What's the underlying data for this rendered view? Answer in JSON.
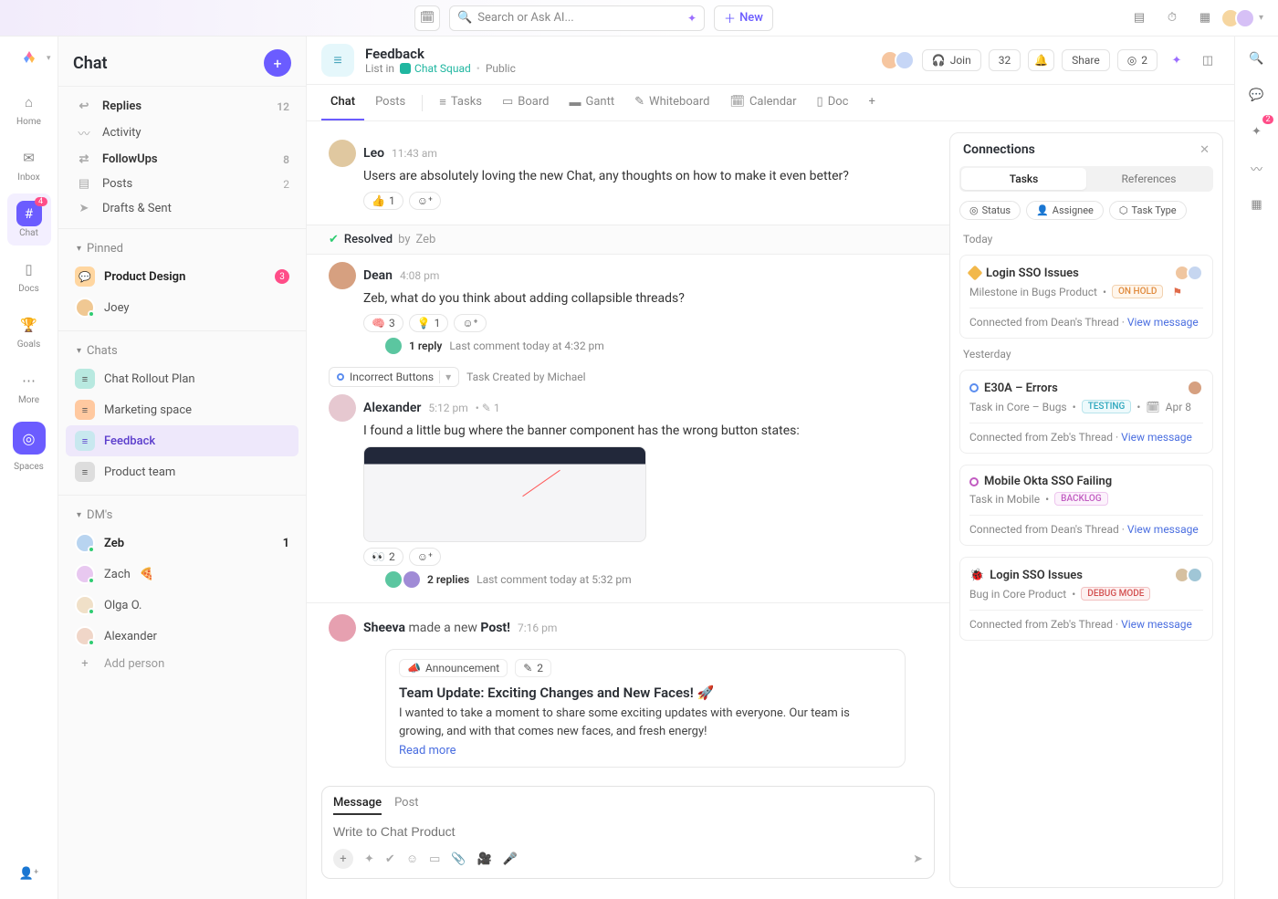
{
  "topbar": {
    "search_placeholder": "Search or Ask AI...",
    "new_label": "New"
  },
  "rail": {
    "items": [
      {
        "label": "Home"
      },
      {
        "label": "Inbox"
      },
      {
        "label": "Chat",
        "badge": "4"
      },
      {
        "label": "Docs"
      },
      {
        "label": "Goals"
      },
      {
        "label": "More"
      }
    ],
    "spaces_label": "Spaces"
  },
  "sidebar": {
    "title": "Chat",
    "nav": [
      {
        "label": "Replies",
        "count": "12",
        "bold": true,
        "icon": "↩"
      },
      {
        "label": "Activity",
        "icon": "⟳"
      },
      {
        "label": "FollowUps",
        "count": "8",
        "bold": true,
        "icon": "⇄"
      },
      {
        "label": "Posts",
        "count": "2",
        "icon": "▤"
      },
      {
        "label": "Drafts & Sent",
        "icon": "➤"
      }
    ],
    "pinned_label": "Pinned",
    "pinned": [
      {
        "label": "Product Design",
        "badge": "3",
        "bold": true
      },
      {
        "label": "Joey"
      }
    ],
    "chats_label": "Chats",
    "chats": [
      {
        "label": "Chat Rollout Plan"
      },
      {
        "label": "Marketing space"
      },
      {
        "label": "Feedback",
        "active": true
      },
      {
        "label": "Product team"
      }
    ],
    "dms_label": "DM's",
    "dms": [
      {
        "label": "Zeb",
        "badge": "1",
        "bold": true
      },
      {
        "label": "Zach",
        "emoji": "🍕"
      },
      {
        "label": "Olga O."
      },
      {
        "label": "Alexander"
      }
    ],
    "add_person": "Add person"
  },
  "header": {
    "title": "Feedback",
    "sub_prefix": "List in",
    "squad": "Chat Squad",
    "visibility": "Public",
    "join_label": "Join",
    "member_count": "32",
    "share_label": "Share",
    "viewers": "2"
  },
  "tabs": {
    "primary": [
      "Chat",
      "Posts"
    ],
    "views": [
      "Tasks",
      "Board",
      "Gantt",
      "Whiteboard",
      "Calendar",
      "Doc"
    ]
  },
  "messages": [
    {
      "author": "Leo",
      "time": "11:43 am",
      "text": "Users are absolutely loving the new Chat, any thoughts on how to make it even better?",
      "reactions": [
        {
          "emoji": "👍",
          "count": "1"
        }
      ]
    }
  ],
  "resolved": {
    "label": "Resolved",
    "by_prefix": "by",
    "by": "Zeb"
  },
  "msg2": {
    "author": "Dean",
    "time": "4:08 pm",
    "text": "Zeb, what do you think about adding collapsible threads?",
    "reactions": [
      {
        "emoji": "🧠",
        "count": "3"
      },
      {
        "emoji": "💡",
        "count": "1"
      }
    ],
    "reply_count": "1 reply",
    "reply_meta": "Last comment today at 4:32 pm"
  },
  "task_created": {
    "name": "Incorrect Buttons",
    "label": "Task Created",
    "by_prefix": "by",
    "by": "Michael"
  },
  "msg3": {
    "author": "Alexander",
    "time": "5:12 pm",
    "extra": "1",
    "text": "I found a little bug where the banner component has the wrong button states:",
    "reactions": [
      {
        "emoji": "👀",
        "count": "2"
      }
    ],
    "reply_count": "2 replies",
    "reply_meta": "Last comment today at 5:32 pm"
  },
  "post": {
    "author": "Sheeva",
    "action": "made a new",
    "kind": "Post!",
    "time": "7:16 pm",
    "tag": "Announcement",
    "tag_count": "2",
    "title": "Team Update: Exciting Changes and New Faces! 🚀",
    "body": "I wanted to take a moment to share some exciting updates with everyone. Our team is growing, and with that comes new faces, and fresh energy!",
    "readmore": "Read more"
  },
  "composer": {
    "tabs": [
      "Message",
      "Post"
    ],
    "placeholder": "Write to Chat Product"
  },
  "connections": {
    "title": "Connections",
    "tabs": [
      "Tasks",
      "References"
    ],
    "filters": [
      "Status",
      "Assignee",
      "Task Type"
    ],
    "today_label": "Today",
    "yesterday_label": "Yesterday",
    "view_message": "View message",
    "cards": {
      "c1": {
        "title": "Login SSO Issues",
        "sub": "Milestone in Bugs Product",
        "status": "ON HOLD",
        "foot": "Connected from Dean's Thread"
      },
      "c2": {
        "title": "E30A – Errors",
        "sub": "Task in Core – Bugs",
        "status": "TESTING",
        "date": "Apr 8",
        "foot": "Connected from Zeb's Thread"
      },
      "c3": {
        "title": "Mobile Okta SSO Failing",
        "sub": "Task in Mobile",
        "status": "BACKLOG",
        "foot": "Connected from Dean's Thread"
      },
      "c4": {
        "title": "Login SSO Issues",
        "sub": "Bug in Core Product",
        "status": "DEBUG MODE",
        "foot": "Connected from Zeb's Thread"
      }
    }
  },
  "right_rail": {
    "chat_badge": "2"
  }
}
